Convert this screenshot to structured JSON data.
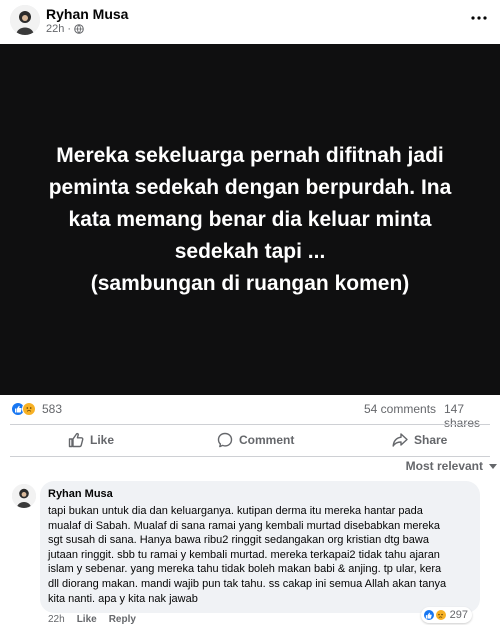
{
  "post": {
    "author": "Ryhan Musa",
    "time": "22h",
    "meta_separator": "·",
    "image_text": "Mereka sekeluarga pernah difitnah jadi\npeminta sedekah dengan berpurdah. Ina\nkata memang benar dia keluar minta\nsedekah tapi ...\n(sambungan di ruangan komen)"
  },
  "engagement": {
    "reaction_count": "583",
    "comments": "54 comments",
    "shares": "147 shares",
    "reaction_icons": [
      "like-icon",
      "sad-icon"
    ]
  },
  "actions": {
    "like": "Like",
    "comment": "Comment",
    "share": "Share"
  },
  "sort": {
    "label": "Most relevant"
  },
  "comment": {
    "author": "Ryhan Musa",
    "text": "tapi bukan untuk dia dan keluarganya. kutipan derma itu mereka hantar pada\nmualaf di Sabah. Mualaf di sana ramai yang kembali murtad disebabkan mereka\nsgt susah di sana. Hanya bawa ribu2 ringgit sedangakan org kristian dtg bawa\njutaan ringgit. sbb tu ramai y kembali murtad. mereka terkapai2 tidak tahu ajaran\nislam y sebenar. yang mereka tahu tidak boleh makan babi & anjing. tp ular, kera\ndll diorang makan. mandi wajib pun tak tahu. ss cakap ini semua Allah akan tanya\nkita nanti. apa y kita nak jawab",
    "reaction_count": "297",
    "time": "22h",
    "like_label": "Like",
    "reply_label": "Reply"
  },
  "colors": {
    "brand_blue": "#1877f2",
    "sad_yellow": "#f7b125",
    "muted_text": "#65676b",
    "media_background": "#0f0f10",
    "comment_bubble": "#f0f2f5"
  }
}
